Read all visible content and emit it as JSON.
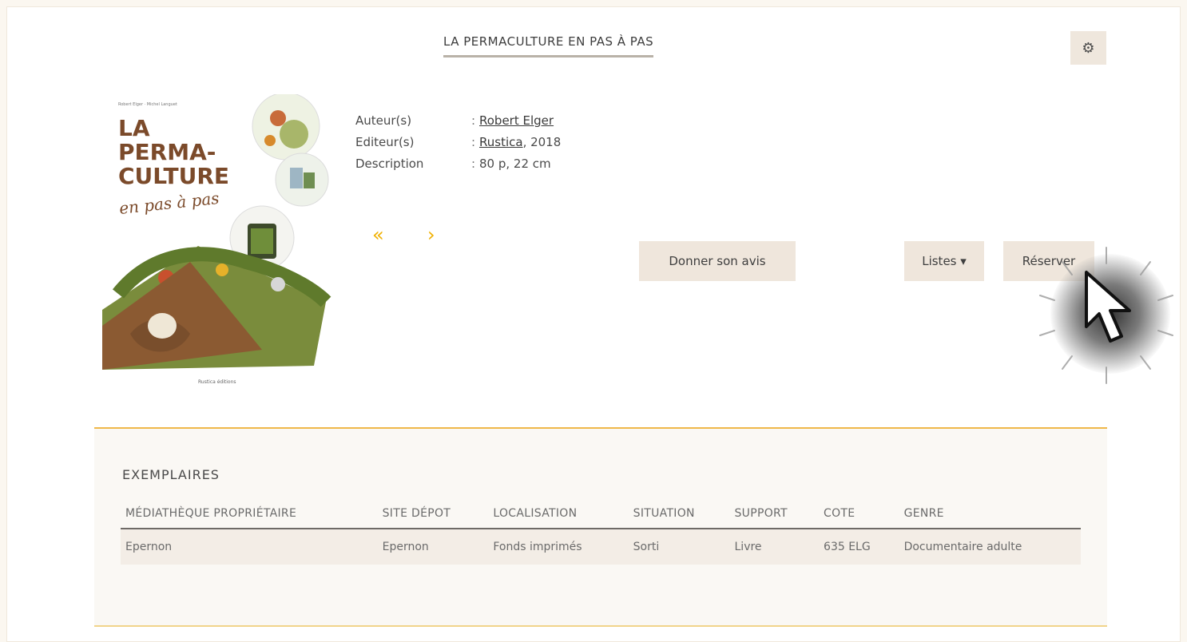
{
  "page": {
    "title": "LA PERMACULTURE EN PAS À PAS",
    "settings_icon": "gear-icon"
  },
  "book": {
    "cover": {
      "top_small": "Robert Elger · Michel Languet",
      "line1": "LA",
      "line2": "PERMA-",
      "line3": "CULTURE",
      "line4": "en pas à pas",
      "publisher_mark": "Rustica éditions"
    },
    "meta": [
      {
        "label": "Auteur(s)",
        "sep": ":",
        "link": "Robert Elger",
        "rest": ""
      },
      {
        "label": "Editeur(s)",
        "sep": ":",
        "link": "Rustica",
        "rest": ", 2018"
      },
      {
        "label": "Description",
        "sep": ":",
        "link": "",
        "rest": "80 p, 22 cm"
      }
    ],
    "prev_arrow": "«",
    "next_arrow": "›"
  },
  "actions": {
    "avis": "Donner son avis",
    "listes": "Listes ▾",
    "reserver": "Réserver"
  },
  "copies": {
    "title": "EXEMPLAIRES",
    "columns": [
      "MÉDIATHÈQUE PROPRIÉTAIRE",
      "SITE DÉPOT",
      "LOCALISATION",
      "SITUATION",
      "SUPPORT",
      "COTE",
      "GENRE"
    ],
    "rows": [
      [
        "Epernon",
        "Epernon",
        "Fonds imprimés",
        "Sorti",
        "Livre",
        "635 ELG",
        "Documentaire adulte"
      ]
    ]
  },
  "colors": {
    "accent": "#f0b000",
    "button_bg": "#efe6dc",
    "section_border": "#efb84a"
  }
}
